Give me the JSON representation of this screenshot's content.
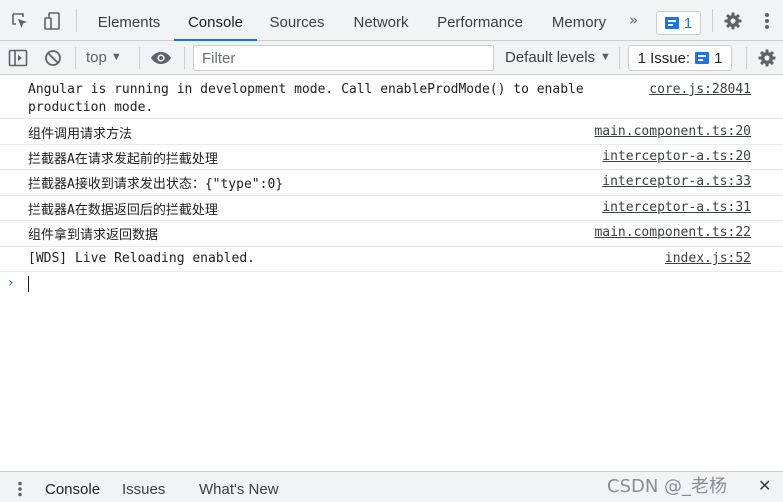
{
  "tabs": [
    {
      "label": "Elements"
    },
    {
      "label": "Console"
    },
    {
      "label": "Sources"
    },
    {
      "label": "Network"
    },
    {
      "label": "Performance"
    },
    {
      "label": "Memory"
    }
  ],
  "active_tab": "Console",
  "more_tabs_glyph": "»",
  "message_badge": {
    "count": "1"
  },
  "toolbar": {
    "context": "top",
    "filter_placeholder": "Filter",
    "filter_value": "",
    "levels_label": "Default levels",
    "issues_label": "1 Issue:",
    "issues_count": "1"
  },
  "messages": [
    {
      "text": "Angular is running in development mode. Call enableProdMode() to enable\nproduction mode.",
      "source": "core.js:28041"
    },
    {
      "text": "组件调用请求方法",
      "source": "main.component.ts:20"
    },
    {
      "text": "拦截器A在请求发起前的拦截处理",
      "source": "interceptor-a.ts:20"
    },
    {
      "text": "拦截器A接收到请求发出状态：{\"type\":0}",
      "source": "interceptor-a.ts:33"
    },
    {
      "text": "拦截器A在数据返回后的拦截处理",
      "source": "interceptor-a.ts:31"
    },
    {
      "text": "组件拿到请求返回数据",
      "source": "main.component.ts:22"
    },
    {
      "text": "[WDS] Live Reloading enabled.",
      "source": "index.js:52"
    }
  ],
  "drawer": {
    "tabs": [
      {
        "label": "Console"
      },
      {
        "label": "Issues"
      },
      {
        "label": "What's New"
      }
    ],
    "watermark": "CSDN @_老杨"
  },
  "colors": {
    "accent": "#1a73e8",
    "toolbar_bg": "#f1f3f4",
    "border": "#cbcdd1"
  }
}
